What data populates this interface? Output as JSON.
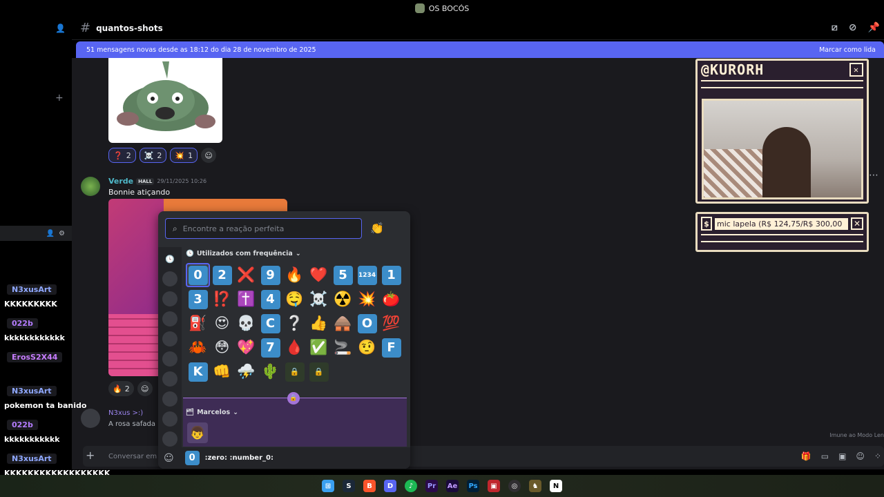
{
  "window": {
    "title": "OS BOCÓS"
  },
  "channel": {
    "name": "quantos-shots"
  },
  "banner": {
    "text": "51 mensagens novas desde as 18:12 do dia 28 de novembro de 2025",
    "action": "Marcar como lida"
  },
  "first_reactions": [
    {
      "emoji": "❓",
      "count": "2"
    },
    {
      "emoji": "☠️",
      "count": "2"
    },
    {
      "emoji": "💥",
      "count": "1"
    }
  ],
  "message": {
    "author": "Verde",
    "tag": "HALL",
    "timestamp": "29/11/2025 10:26",
    "text": "Bonnie atiçando"
  },
  "second_reactions": [
    {
      "emoji": "🔥",
      "count": "2"
    }
  ],
  "message2": {
    "author": "N3xus >:)",
    "text": "A rosa safada"
  },
  "composer": {
    "placeholder": "Conversar em"
  },
  "immune_note": "Imune ao Modo Len",
  "stream_overlay": {
    "handle": "@KURORH",
    "ticker": "mic lapela (R$ 124,75/R$ 300,00"
  },
  "emoji_picker": {
    "search_placeholder": "Encontre a reação perfeita",
    "section_frequent": "Utilizados com frequência",
    "section_server": "Marcelos",
    "footer_name": ":zero: :number_0:",
    "footer_emoji": "0",
    "emojis": [
      {
        "t": "key",
        "v": "0"
      },
      {
        "t": "key",
        "v": "2"
      },
      {
        "t": "e",
        "v": "❌"
      },
      {
        "t": "key",
        "v": "9"
      },
      {
        "t": "e",
        "v": "🔥"
      },
      {
        "t": "e",
        "v": "❤️"
      },
      {
        "t": "key",
        "v": "5"
      },
      {
        "t": "key",
        "v": "1234"
      },
      {
        "t": "key",
        "v": "1"
      },
      {
        "t": "key",
        "v": "3"
      },
      {
        "t": "e",
        "v": "⁉️"
      },
      {
        "t": "e",
        "v": "✝️"
      },
      {
        "t": "key",
        "v": "4"
      },
      {
        "t": "e",
        "v": "🤤"
      },
      {
        "t": "e",
        "v": "☠️"
      },
      {
        "t": "e",
        "v": "☢️"
      },
      {
        "t": "e",
        "v": "💥"
      },
      {
        "t": "e",
        "v": "🍅"
      },
      {
        "t": "e",
        "v": "⛽"
      },
      {
        "t": "e",
        "v": "😍"
      },
      {
        "t": "e",
        "v": "💀"
      },
      {
        "t": "key",
        "v": "C"
      },
      {
        "t": "e",
        "v": "❔"
      },
      {
        "t": "e",
        "v": "👍"
      },
      {
        "t": "e",
        "v": "🛖"
      },
      {
        "t": "key",
        "v": "O"
      },
      {
        "t": "e",
        "v": "💯"
      },
      {
        "t": "e",
        "v": "🦀"
      },
      {
        "t": "e",
        "v": "😳"
      },
      {
        "t": "e",
        "v": "💖"
      },
      {
        "t": "key",
        "v": "7"
      },
      {
        "t": "e",
        "v": "🩸"
      },
      {
        "t": "e",
        "v": "✅"
      },
      {
        "t": "e",
        "v": "🚬"
      },
      {
        "t": "e",
        "v": "🤨"
      },
      {
        "t": "key",
        "v": "F"
      },
      {
        "t": "key",
        "v": "K"
      },
      {
        "t": "e",
        "v": "👊"
      },
      {
        "t": "e",
        "v": "⛈️"
      },
      {
        "t": "e",
        "v": "🌵"
      },
      {
        "t": "lock",
        "v": "🔒"
      },
      {
        "t": "lock",
        "v": "🔒"
      }
    ]
  },
  "twitch_chat": [
    {
      "name": "N3xusArt",
      "color": "#8fa8ff",
      "msg": "KKKKKKKKK"
    },
    {
      "name": "022b",
      "color": "#b47cff",
      "msg": "kkkkkkkkkkkk"
    },
    {
      "name": "ErosS2X44",
      "color": "#c77dff",
      "msg": ""
    },
    {
      "name": "N3xusArt",
      "color": "#8fa8ff",
      "msg": "pokemon ta banido"
    },
    {
      "name": "022b",
      "color": "#b47cff",
      "msg": "kkkkkkkkkkk"
    },
    {
      "name": "N3xusArt",
      "color": "#8fa8ff",
      "msg": "KKKKKKKKKKKKKKKKKK KKKKKKKKKKKKKKK"
    }
  ]
}
